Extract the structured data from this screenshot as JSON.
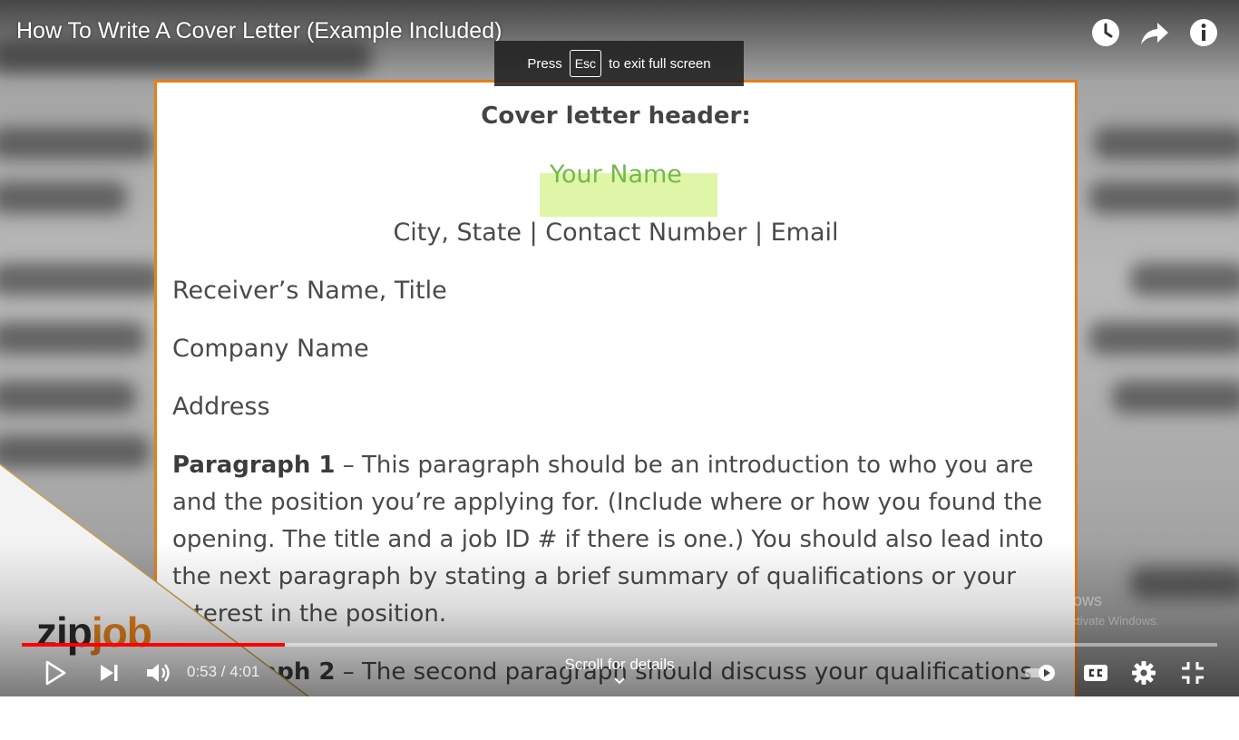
{
  "video": {
    "title": "How To Write A Cover Letter (Example Included)",
    "esc_toast": {
      "prefix": "Press",
      "key": "Esc",
      "suffix": "to exit full screen"
    }
  },
  "slide": {
    "header": "Cover letter header:",
    "your_name": "Your Name",
    "contact_line": "City, State | Contact Number | Email",
    "receiver": "Receiver’s Name, Title",
    "company": "Company Name",
    "address": "Address",
    "paragraph1_label": "Paragraph 1",
    "paragraph1_text": " – This paragraph should be an introduction to who you are and the position you’re applying for. (Include where or how you found the opening. The title and a job ID # if there is one.) You should also lead into the next paragraph by stating a brief summary of qualifications or your interest in the position.",
    "paragraph2_label": "Paragraph 2",
    "paragraph2_text": " – The second paragraph should discuss your qualifications"
  },
  "branding": {
    "logo_zip": "zip",
    "logo_job": "job"
  },
  "watermark": {
    "title": "Activate Windows",
    "subtitle": "Go to Settings to activate Windows."
  },
  "player": {
    "current_time": "0:53",
    "duration": "4:01",
    "time_display": "0:53 / 4:01",
    "progress_fraction": 0.22,
    "scroll_hint": "Scroll for details",
    "icons": [
      "watch-later-icon",
      "share-icon",
      "info-icon",
      "play-icon",
      "next-icon",
      "volume-icon",
      "autoplay-toggle",
      "captions-icon",
      "settings-icon",
      "exit-fullscreen-icon"
    ]
  },
  "colors": {
    "accent_orange": "#e47f1c",
    "progress_red": "#ff0000",
    "highlight": "#dff5a8",
    "name_green": "#75b84b"
  }
}
